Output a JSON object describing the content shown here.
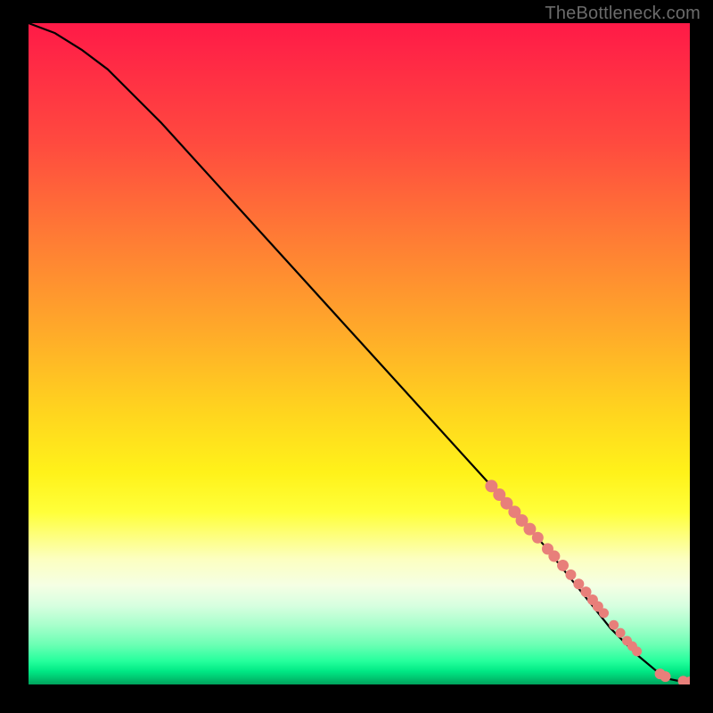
{
  "watermark_text": "TheBottleneck.com",
  "chart_data": {
    "type": "line",
    "title": "",
    "xlabel": "",
    "ylabel": "",
    "xlim": [
      0,
      100
    ],
    "ylim": [
      0,
      100
    ],
    "series": [
      {
        "name": "curve",
        "x": [
          0,
          4,
          8,
          12,
          20,
          30,
          40,
          50,
          60,
          70,
          78,
          84,
          88,
          92,
          95,
          97,
          98.5,
          100
        ],
        "y": [
          100,
          98.5,
          96,
          93,
          85,
          74,
          63,
          52,
          41,
          30,
          21,
          13.5,
          8.5,
          4.5,
          2,
          0.8,
          0.5,
          0.4
        ]
      }
    ],
    "markers": {
      "name": "cluster-points",
      "x": [
        70,
        71.2,
        72.3,
        73.5,
        74.6,
        75.8,
        77.0,
        78.5,
        79.5,
        80.8,
        82.0,
        83.2,
        84.3,
        85.3,
        86.1,
        87.0,
        88.5,
        89.5,
        90.5,
        91.3,
        92.0,
        95.5,
        96.3,
        99.0,
        100.0
      ],
      "y": [
        30.0,
        28.7,
        27.4,
        26.1,
        24.8,
        23.5,
        22.2,
        20.5,
        19.4,
        18.0,
        16.6,
        15.2,
        14.0,
        12.8,
        11.8,
        10.8,
        9.0,
        7.8,
        6.6,
        5.8,
        5.0,
        1.6,
        1.2,
        0.5,
        0.4
      ],
      "r": [
        7,
        7,
        7,
        7,
        7,
        7,
        6.5,
        6.5,
        6.5,
        6.5,
        6,
        6,
        6,
        6,
        6,
        5.5,
        5.5,
        5.5,
        5.5,
        5.5,
        5.5,
        6,
        6,
        6,
        6
      ]
    }
  },
  "colors": {
    "marker_fill": "#e87f7a",
    "curve_stroke": "#000000",
    "watermark": "#6b6b6b"
  }
}
